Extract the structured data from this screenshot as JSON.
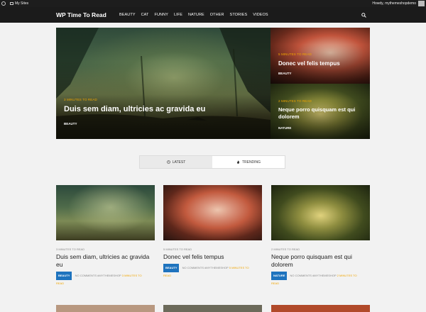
{
  "adminbar": {
    "my_sites": "My Sites",
    "howdy": "Howdy, mythemeshopdemo"
  },
  "header": {
    "logo": "WP Time To Read",
    "nav": [
      "BEAUTY",
      "CAT",
      "FUNNY",
      "LIFE",
      "NATURE",
      "OTHER",
      "STORIES",
      "VIDEOS"
    ]
  },
  "hero": {
    "main": {
      "read": "3 MINUTES TO READ",
      "title": "Duis sem diam, ultricies ac gravida eu",
      "category": "BEAUTY"
    },
    "side": [
      {
        "read": "5 MINUTES TO READ",
        "title": "Donec vel felis tempus",
        "category": "BEAUTY"
      },
      {
        "read": "2 MINUTES TO READ",
        "title": "Neque porro quisquam est qui dolorem",
        "category": "NATURE"
      }
    ]
  },
  "tabs": {
    "latest": "LATEST",
    "trending": "TRENDING"
  },
  "cards": [
    {
      "read": "3 MINUTES TO READ",
      "title": "Duis sem diam, ultricies ac gravida eu",
      "category": "BEAUTY",
      "comments": "NO COMMENTS",
      "author": "#MYTHEMESHOP",
      "time_a": "3 MINUTES TO",
      "time_b": "READ"
    },
    {
      "read": "5 MINUTES TO READ",
      "title": "Donec vel felis tempus",
      "category": "BEAUTY",
      "comments": "NO COMMENTS",
      "author": "#MYTHEMESHOP",
      "time_a": "5 MINUTES TO",
      "time_b": "READ"
    },
    {
      "read": "2 MINUTES TO READ",
      "title": "Neque porro quisquam est qui dolorem",
      "category": "NATURE",
      "comments": "NO COMMENTS",
      "author": "#MYTHEMESHOP",
      "time_a": "2 MINUTES TO",
      "time_b": "READ"
    }
  ],
  "colors": {
    "accent": "#f0a500",
    "badge": "#1e73be",
    "header_bg": "#1b1b1b"
  },
  "icons": {
    "search": "search-icon",
    "latest": "clock-icon",
    "trending": "flame-icon"
  }
}
